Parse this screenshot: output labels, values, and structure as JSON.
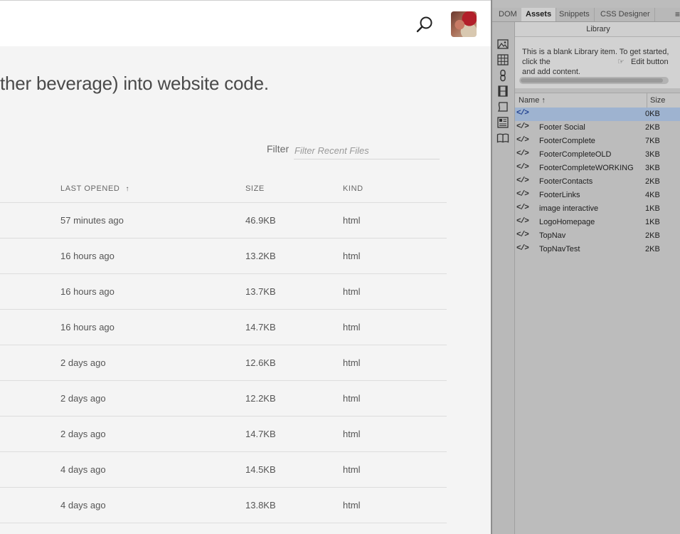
{
  "header": {
    "tagline": "ther beverage) into website code."
  },
  "filter": {
    "label": "Filter",
    "placeholder": "Filter Recent Files"
  },
  "table": {
    "columns": {
      "last_opened": "LAST OPENED",
      "size": "SIZE",
      "kind": "KIND"
    },
    "sort_indicator": "↑",
    "rows": [
      {
        "last_opened": "57 minutes ago",
        "size": "46.9KB",
        "kind": "html"
      },
      {
        "last_opened": "16 hours ago",
        "size": "13.2KB",
        "kind": "html"
      },
      {
        "last_opened": "16 hours ago",
        "size": "13.7KB",
        "kind": "html"
      },
      {
        "last_opened": "16 hours ago",
        "size": "14.7KB",
        "kind": "html"
      },
      {
        "last_opened": "2 days ago",
        "size": "12.6KB",
        "kind": "html"
      },
      {
        "last_opened": "2 days ago",
        "size": "12.2KB",
        "kind": "html"
      },
      {
        "last_opened": "2 days ago",
        "size": "14.7KB",
        "kind": "html"
      },
      {
        "last_opened": "4 days ago",
        "size": "14.5KB",
        "kind": "html"
      },
      {
        "last_opened": "4 days ago",
        "size": "13.8KB",
        "kind": "html"
      }
    ]
  },
  "panel": {
    "tabs": [
      "DOM",
      "Assets",
      "Snippets",
      "CSS Designer"
    ],
    "active_tab": "Assets",
    "menu_icon": "≡",
    "library_title": "Library",
    "preview_message": "This is a blank Library item. To get started, click the",
    "preview_message_end": "and add content.",
    "preview_edit_label": "Edit button",
    "list_columns": {
      "name": "Name",
      "size": "Size"
    },
    "name_sort_indicator": "↑",
    "item_icon": "</>",
    "items": [
      {
        "name": "",
        "size": "0KB",
        "selected": true
      },
      {
        "name": "Footer Social",
        "size": "2KB"
      },
      {
        "name": "FooterComplete",
        "size": "7KB"
      },
      {
        "name": "FooterCompleteOLD",
        "size": "3KB"
      },
      {
        "name": "FooterCompleteWORKING",
        "size": "3KB"
      },
      {
        "name": "FooterContacts",
        "size": "2KB"
      },
      {
        "name": "FooterLinks",
        "size": "4KB"
      },
      {
        "name": "image interactive",
        "size": "1KB"
      },
      {
        "name": "LogoHomepage",
        "size": "1KB"
      },
      {
        "name": "TopNav",
        "size": "2KB"
      },
      {
        "name": "TopNavTest",
        "size": "2KB"
      }
    ],
    "categories": [
      "images-icon",
      "colors-icon",
      "urls-icon",
      "media-icon",
      "templates-icon",
      "library-icon",
      "cc-libraries-icon"
    ]
  },
  "colors": {
    "selection": "#9eb3d0",
    "panel_bg": "#bcbcbc",
    "page_bg": "#f4f4f4"
  }
}
